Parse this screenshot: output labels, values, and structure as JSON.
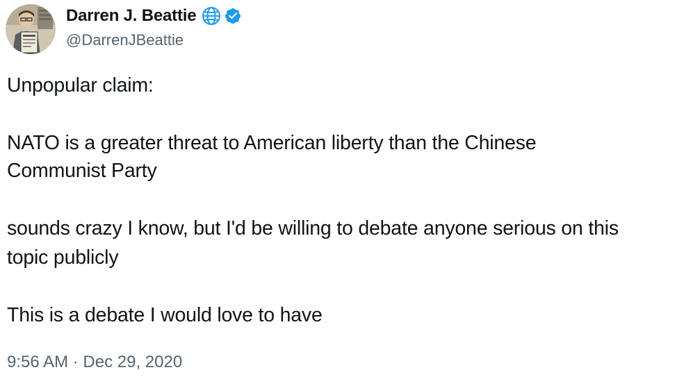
{
  "author": {
    "display_name": "Darren J. Beattie",
    "handle": "@DarrenJBeattie",
    "badges": [
      "globe-icon",
      "verified-icon"
    ],
    "verified_color": "#1d9bf0"
  },
  "tweet": {
    "lines": [
      "Unpopular claim:",
      "NATO is a greater threat to American liberty than the Chinese",
      "Communist Party",
      "sounds crazy I know, but I'd be willing to debate anyone serious on this",
      "topic publicly",
      "This is a debate I would love to have"
    ],
    "time": "9:56 AM",
    "separator": "·",
    "date": "Dec 29, 2020"
  },
  "colors": {
    "text": "#0f1419",
    "secondary": "#536471",
    "accent": "#1d9bf0"
  }
}
